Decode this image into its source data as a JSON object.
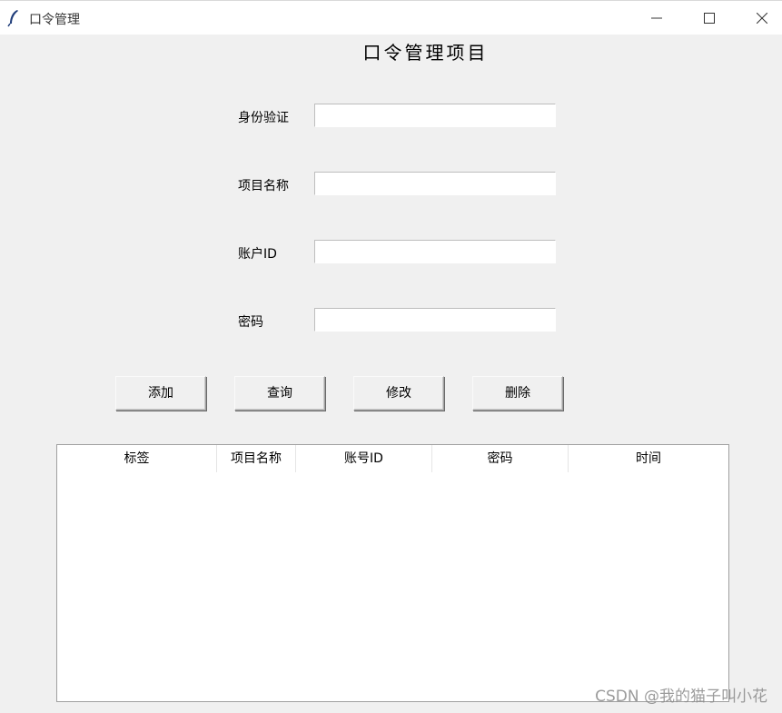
{
  "window": {
    "title": "口令管理",
    "icon": "feather-icon"
  },
  "heading": "口令管理项目",
  "form": {
    "fields": [
      {
        "label": "身份验证",
        "value": ""
      },
      {
        "label": "项目名称",
        "value": ""
      },
      {
        "label": "账户ID",
        "value": ""
      },
      {
        "label": "密码",
        "value": ""
      }
    ]
  },
  "buttons": {
    "add": "添加",
    "query": "查询",
    "modify": "修改",
    "delete": "删除"
  },
  "table": {
    "columns": [
      "标签",
      "项目名称",
      "账号ID",
      "密码",
      "时间"
    ],
    "rows": []
  },
  "watermark": "CSDN @我的猫子叫小花"
}
